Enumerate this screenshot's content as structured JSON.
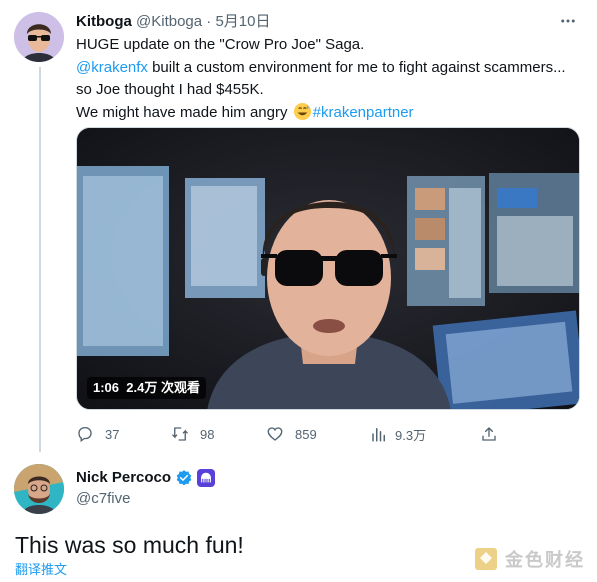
{
  "tweet": {
    "author_name": "Kitboga",
    "author_handle": "@Kitboga",
    "separator": "·",
    "date": "5月10日",
    "text_line1": "HUGE update on the \"Crow Pro Joe\" Saga.",
    "mention": "@krakenfx",
    "text_line2_rest": " built a custom environment for me to fight against scammers...",
    "text_line3": "so Joe thought I had $455K.",
    "text_line4_prefix": "We might have made him angry ",
    "emoji": "sweat-smile-emoji",
    "hashtag": "#krakenpartner",
    "video": {
      "duration": "1:06",
      "views": "2.4万 次观看"
    },
    "actions": {
      "replies": "37",
      "retweets": "98",
      "likes": "859",
      "views": "9.3万"
    }
  },
  "reply": {
    "author_name": "Nick Percoco",
    "author_handle": "@c7five",
    "verified": true,
    "text": "This was so much fun!",
    "translate_label": "翻译推文"
  },
  "watermark": {
    "text": "金色财经",
    "icon": "jinse-logo-icon"
  },
  "colors": {
    "link": "#1d9bf0",
    "muted": "#536471",
    "text": "#0f1419",
    "kraken_purple": "#5741d9"
  }
}
